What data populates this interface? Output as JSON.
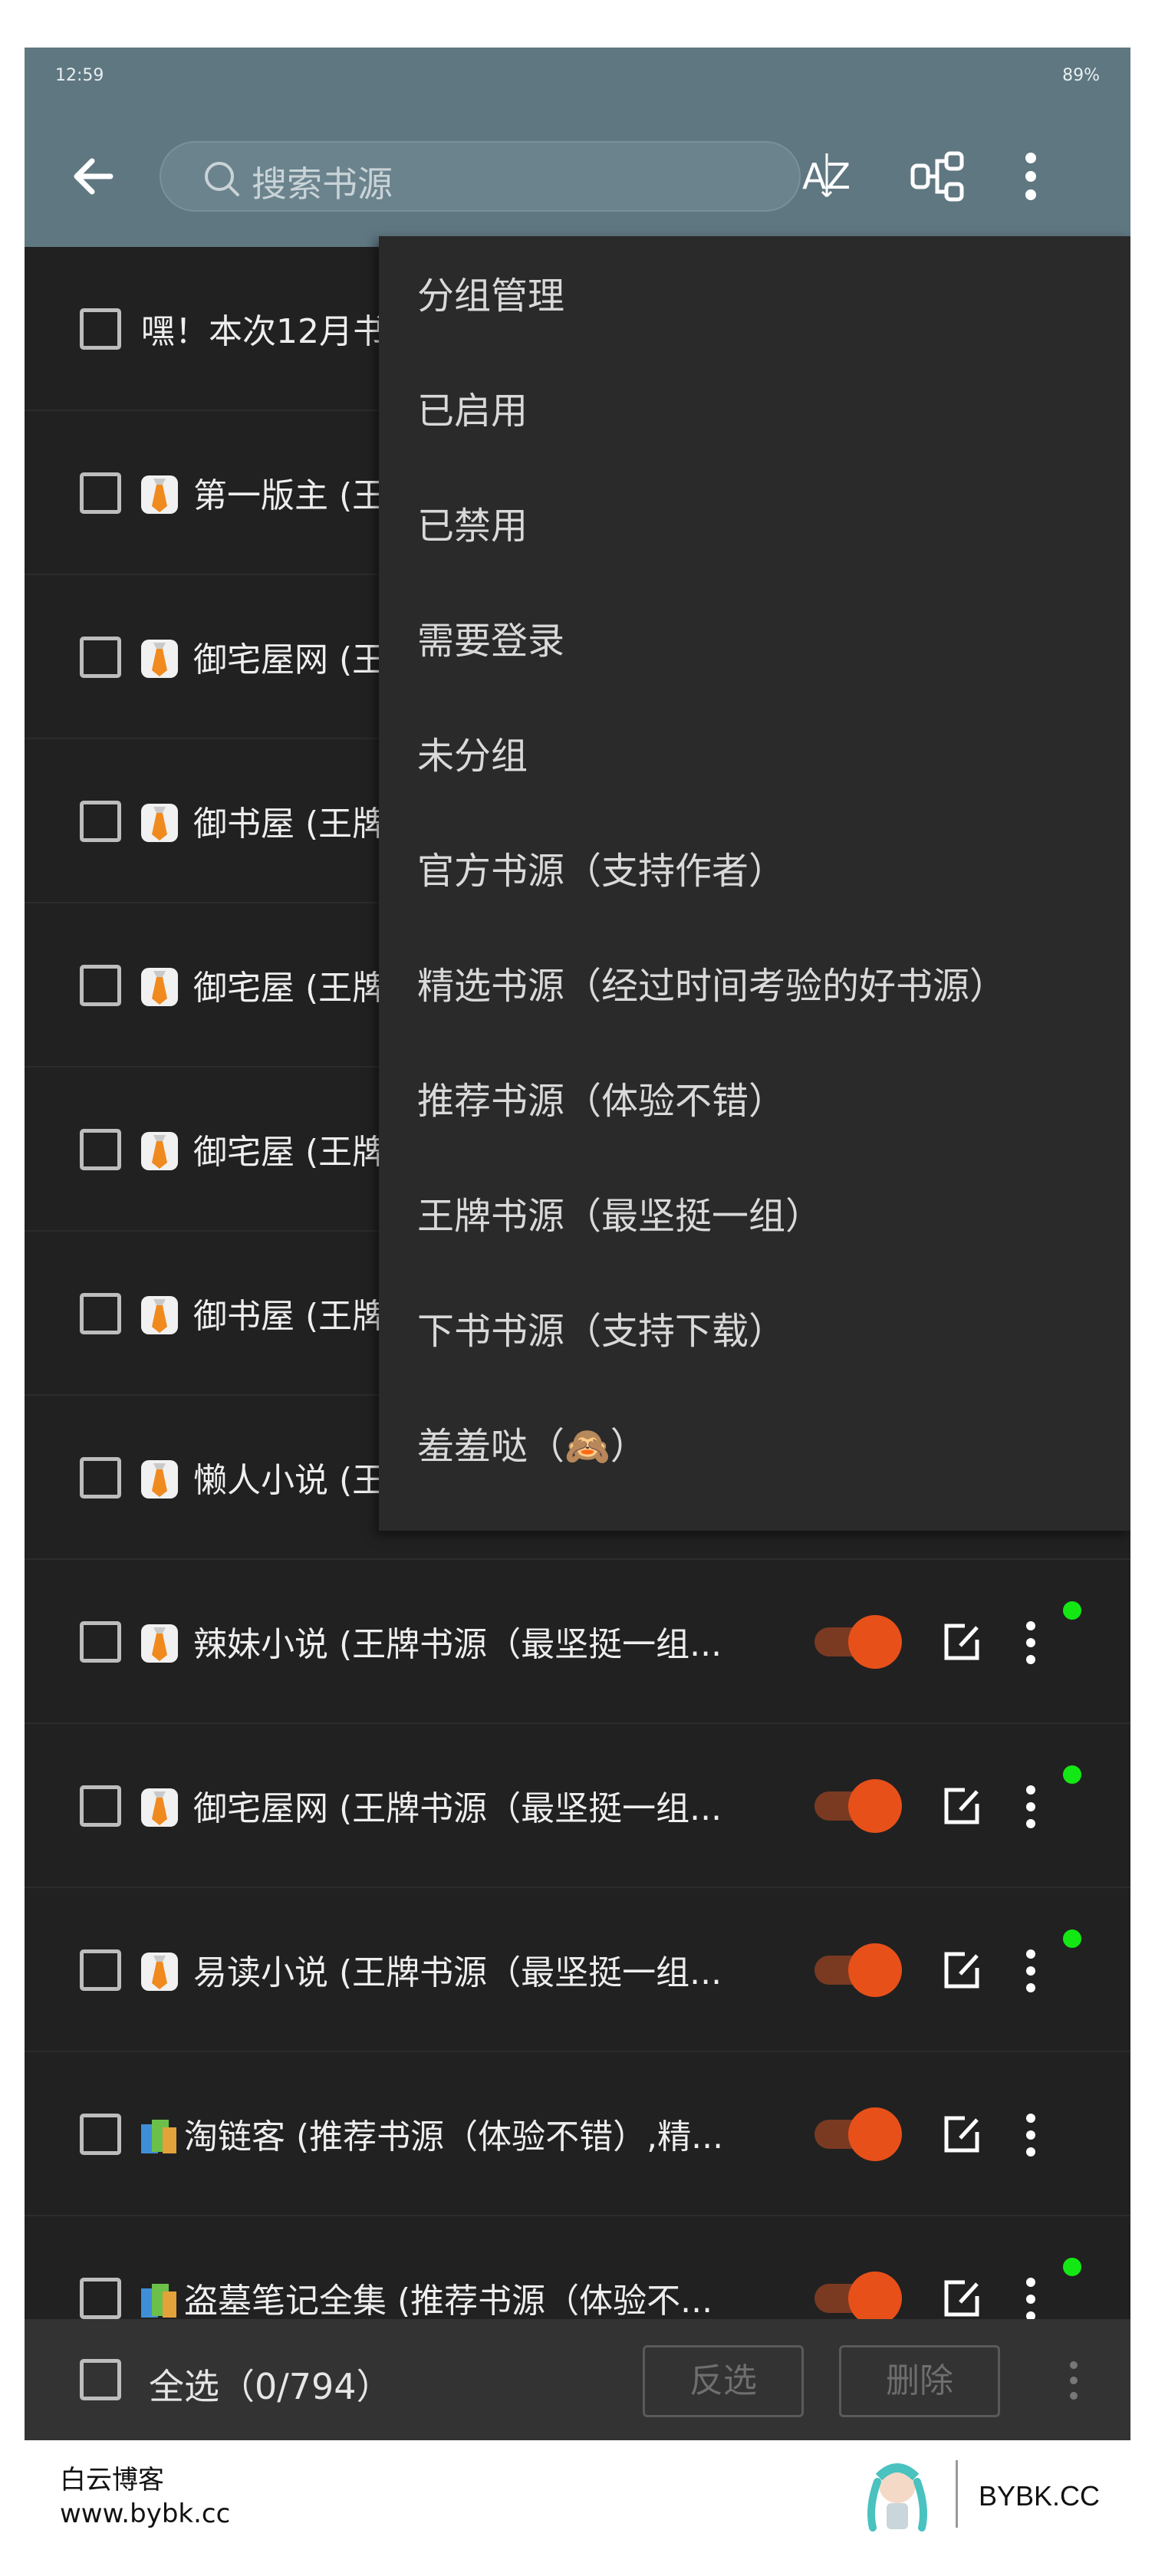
{
  "status": {
    "time": "12:59",
    "right": "89%"
  },
  "appbar": {
    "search_placeholder": "搜索书源"
  },
  "rows": [
    {
      "label": "嘿！本次12月书",
      "icon": "none"
    },
    {
      "label": "第一版主 (王",
      "icon": "tie-icon"
    },
    {
      "label": "御宅屋网 (王",
      "icon": "tie-icon"
    },
    {
      "label": "御书屋 (王牌",
      "icon": "tie-icon"
    },
    {
      "label": "御宅屋 (王牌",
      "icon": "tie-icon"
    },
    {
      "label": "御宅屋 (王牌",
      "icon": "tie-icon"
    },
    {
      "label": "御书屋 (王牌",
      "icon": "tie-icon"
    },
    {
      "label": "懒人小说 (王",
      "icon": "tie-icon"
    },
    {
      "label": "辣妹小说 (王牌书源（最坚挺一组...",
      "icon": "tie-icon"
    },
    {
      "label": "御宅屋网 (王牌书源（最坚挺一组...",
      "icon": "tie-icon"
    },
    {
      "label": "易读小说 (王牌书源（最坚挺一组...",
      "icon": "tie-icon"
    },
    {
      "label": "淘链客 (推荐书源（体验不错）,精...",
      "icon": "books-icon"
    },
    {
      "label": "盗墓笔记全集 (推荐书源（体验不...",
      "icon": "books-icon"
    }
  ],
  "menu": [
    "分组管理",
    "已启用",
    "已禁用",
    "需要登录",
    "未分组",
    "官方书源（支持作者）",
    "精选书源（经过时间考验的好书源）",
    "推荐书源（体验不错）",
    "王牌书源（最坚挺一组）",
    "下书书源（支持下载）",
    "羞羞哒（🙈）"
  ],
  "bottom": {
    "select_all": "全选（0/794）",
    "invert": "反选",
    "delete": "删除"
  },
  "watermark": {
    "name": "白云博客",
    "url": "www.bybk.cc",
    "brand": "BYBK.CC"
  },
  "colors": {
    "appbar": "#5f7781",
    "toggle_on": "#e8501a",
    "online_dot": "#14e814"
  }
}
